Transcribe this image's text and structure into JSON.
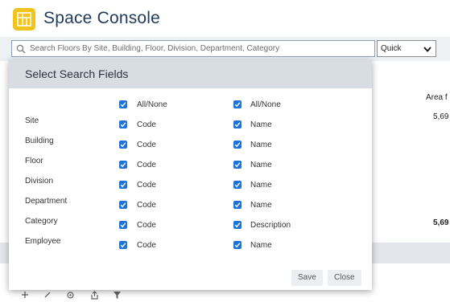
{
  "app": {
    "title": "Space Console"
  },
  "search": {
    "placeholder": "Search Floors By Site, Building, Floor, Division, Department, Category",
    "mode": "Quick"
  },
  "background": {
    "area_header": "Area f",
    "area_value": "5,69",
    "area_total": "5,69"
  },
  "dialog": {
    "title": "Select Search Fields",
    "header_row": {
      "col1": "All/None",
      "col2": "All/None",
      "col1_checked": true,
      "col2_checked": true
    },
    "rows": [
      {
        "label": "Site",
        "col1": "Code",
        "col2": "Name"
      },
      {
        "label": "Building",
        "col1": "Code",
        "col2": "Name"
      },
      {
        "label": "Floor",
        "col1": "Code",
        "col2": "Name"
      },
      {
        "label": "Division",
        "col1": "Code",
        "col2": "Name"
      },
      {
        "label": "Department",
        "col1": "Code",
        "col2": "Name"
      },
      {
        "label": "Category",
        "col1": "Code",
        "col2": "Description"
      },
      {
        "label": "Employee",
        "col1": "Code",
        "col2": "Name"
      }
    ],
    "save_label": "Save",
    "close_label": "Close"
  },
  "colors": {
    "accent": "#1e73d8",
    "logo": "#f2c318",
    "header_band": "#d7dde3"
  },
  "icons": [
    "app-logo-icon",
    "search-icon",
    "chevron-down-icon",
    "checkbox-checked-icon",
    "add-icon",
    "edit-icon",
    "settings-icon",
    "export-icon",
    "filter-icon"
  ]
}
